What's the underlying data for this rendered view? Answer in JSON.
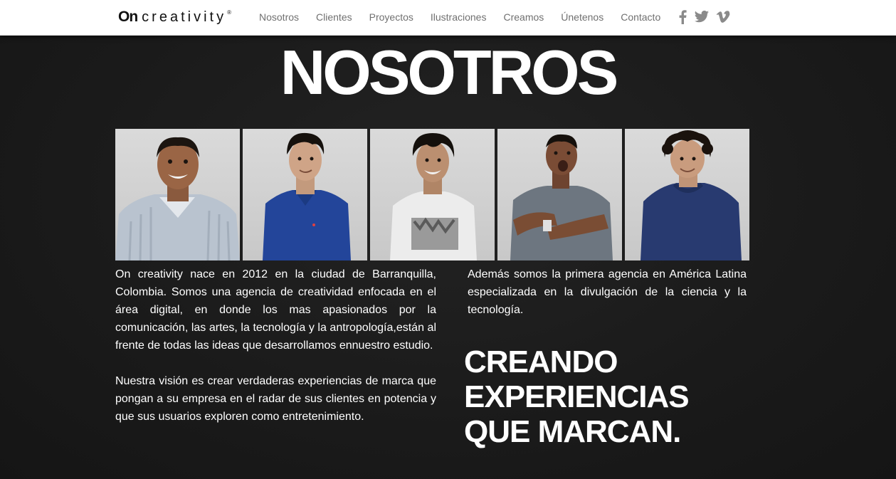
{
  "header": {
    "logo_on": "On",
    "logo_word": "creativity",
    "logo_reg": "®",
    "nav": [
      "Nosotros",
      "Clientes",
      "Proyectos",
      "Ilustraciones",
      "Creamos",
      "Únetenos",
      "Contacto"
    ],
    "social": [
      "facebook-icon",
      "twitter-icon",
      "vimeo-icon"
    ],
    "nav_color": "#707070"
  },
  "page": {
    "title": "NOSOTROS",
    "background": "#1b1b1b"
  },
  "team_photos": [
    "team-member-1",
    "team-member-2",
    "team-member-3",
    "team-member-4",
    "team-member-5"
  ],
  "content": {
    "left_p1": "On creativity nace en 2012 en la ciudad de Barranquilla, Colombia. Somos una agencia de creatividad enfocada en el área digital, en donde los mas apasionados por la comunicación, las artes, la tecnología y la antropología,están al frente de todas las ideas que desarrollamos ennuestro estudio.",
    "left_p2": "Nuestra visión es crear verdaderas experiencias de marca que pongan a su empresa en el radar de sus clientes en potencia y que sus usuarios exploren como entretenimiento.",
    "right_p1": "Además somos la primera agencia en América Latina especializada en la divulgación de la ciencia y la tecnología.",
    "slogan": [
      "CREANDO",
      "EXPERIENCIAS",
      "QUE MARCAN."
    ]
  }
}
